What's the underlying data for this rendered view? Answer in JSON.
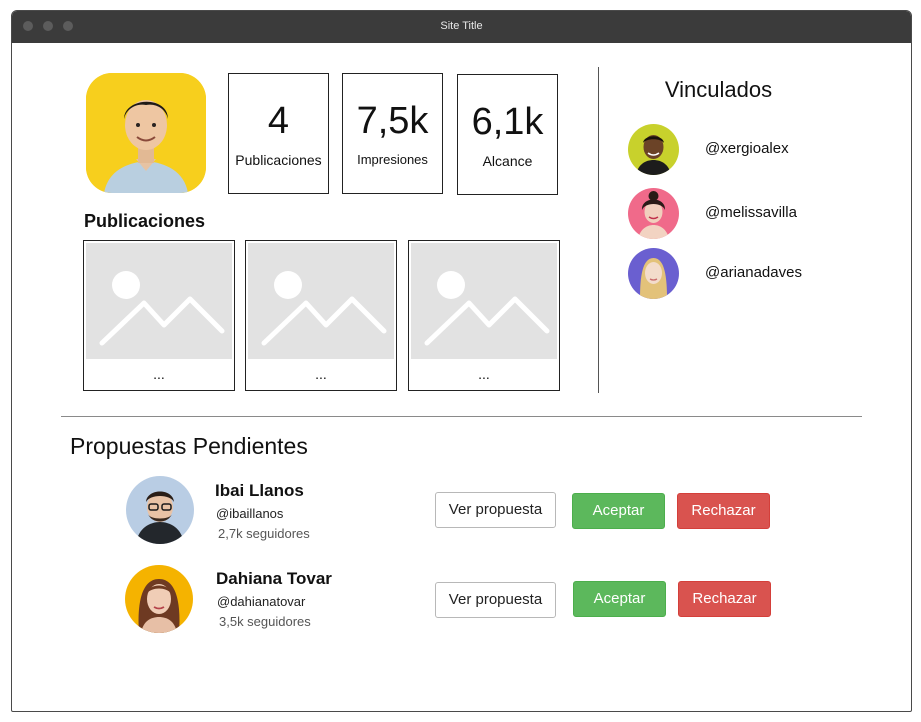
{
  "window": {
    "title": "Site Title"
  },
  "profile": {
    "avatar_icon": "profile-avatar",
    "stats": [
      {
        "value": "4",
        "label": "Publicaciones"
      },
      {
        "value": "7,5k",
        "label": "Impresiones"
      },
      {
        "value": "6,1k",
        "label": "Alcance"
      }
    ]
  },
  "publications": {
    "heading": "Publicaciones",
    "items": [
      {
        "caption": "..."
      },
      {
        "caption": "..."
      },
      {
        "caption": "..."
      }
    ]
  },
  "linked": {
    "heading": "Vinculados",
    "users": [
      {
        "handle": "@xergioalex",
        "avatar_color": "#c8d12c"
      },
      {
        "handle": "@melissavilla",
        "avatar_color": "#f06a8a"
      },
      {
        "handle": "@arianadaves",
        "avatar_color": "#6a5fd0"
      }
    ]
  },
  "proposals": {
    "heading": "Propuestas Pendientes",
    "items": [
      {
        "name": "Ibai Llanos",
        "handle": "@ibaillanos",
        "followers": "2,7k seguidores",
        "avatar_color": "#b9cde4"
      },
      {
        "name": "Dahiana Tovar",
        "handle": "@dahianatovar",
        "followers": "3,5k seguidores",
        "avatar_color": "#f5b300"
      }
    ],
    "view_label": "Ver propuesta",
    "accept_label": "Aceptar",
    "reject_label": "Rechazar"
  },
  "colors": {
    "accept": "#5cb85c",
    "reject": "#d9534f",
    "titlebar": "#3b3b3b"
  }
}
